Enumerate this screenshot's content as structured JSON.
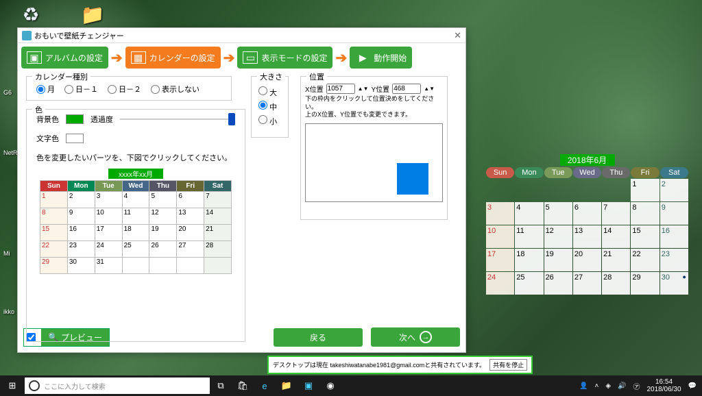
{
  "window": {
    "title": "おもいで壁紙チェンジャー"
  },
  "steps": {
    "album": "アルバムの設定",
    "calendar": "カレンダーの設定",
    "display": "表示モードの設定",
    "start": "動作開始"
  },
  "type": {
    "legend": "カレンダー種別",
    "options": [
      "月",
      "日－１",
      "日－２",
      "表示しない"
    ]
  },
  "color": {
    "legend": "色",
    "bg": "背景色",
    "opacity": "透過度",
    "fg": "文字色",
    "note": "色を変更したいパーツを、下図でクリックしてください。",
    "bg_hex": "#0a0",
    "fg_hex": "#fff"
  },
  "mini_cal": {
    "header": "xxxx年xx月",
    "days": [
      "Sun",
      "Mon",
      "Tue",
      "Wed",
      "Thu",
      "Fri",
      "Sat"
    ],
    "rows": [
      [
        "1",
        "2",
        "3",
        "4",
        "5",
        "6",
        "7"
      ],
      [
        "8",
        "9",
        "10",
        "11",
        "12",
        "13",
        "14"
      ],
      [
        "15",
        "16",
        "17",
        "18",
        "19",
        "20",
        "21"
      ],
      [
        "22",
        "23",
        "24",
        "25",
        "26",
        "27",
        "28"
      ],
      [
        "29",
        "30",
        "31",
        "",
        "",
        "",
        ""
      ]
    ]
  },
  "size": {
    "legend": "大きさ",
    "options": [
      "大",
      "中",
      "小"
    ]
  },
  "position": {
    "legend": "位置",
    "x_label": "X位置",
    "x": "1057",
    "y_label": "Y位置",
    "y": "468",
    "note1": "下の枠内をクリックして位置決めをしてください。",
    "note2": "上のX位置、Y位置でも変更できます。"
  },
  "buttons": {
    "preview": "プレビュー",
    "back": "戻る",
    "next": "次へ"
  },
  "desk_cal": {
    "title": "2018年6月",
    "days": [
      "Sun",
      "Mon",
      "Tue",
      "Wed",
      "Thu",
      "Fri",
      "Sat"
    ],
    "cells": [
      "",
      "",
      "",
      "",
      "",
      "1",
      "2",
      "3",
      "4",
      "5",
      "6",
      "7",
      "8",
      "9",
      "10",
      "11",
      "12",
      "13",
      "14",
      "15",
      "16",
      "17",
      "18",
      "19",
      "20",
      "21",
      "22",
      "23",
      "24",
      "25",
      "26",
      "27",
      "28",
      "29",
      "30"
    ],
    "today": "30"
  },
  "share": {
    "text": "デスクトップは現在 takeshiwatanabe1981@gmail.comと共有されています。",
    "btn": "共有を停止"
  },
  "taskbar": {
    "search_placeholder": "ここに入力して検索",
    "time": "16:54",
    "date": "2018/06/30"
  }
}
